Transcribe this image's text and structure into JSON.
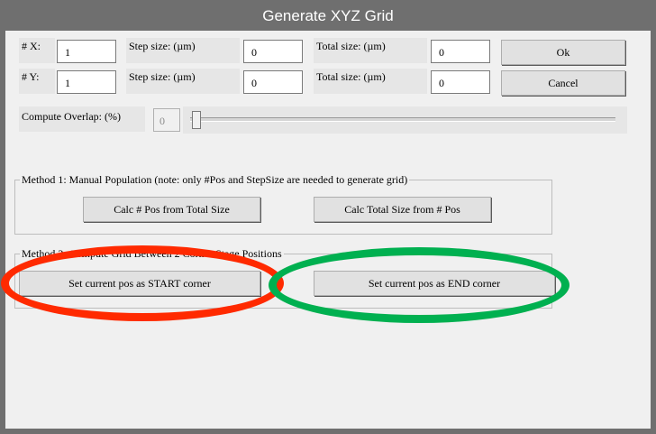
{
  "window": {
    "title": "Generate XYZ Grid",
    "bg_color": "#6f6f6f",
    "client_bg": "#f0f0f0"
  },
  "grid": {
    "x_label": "# X:",
    "x_value": "1",
    "y_label": "# Y:",
    "y_value": "1",
    "step_label_x": "Step size: (µm)",
    "step_value_x": "0",
    "step_label_y": "Step size: (µm)",
    "step_value_y": "0",
    "total_label_x": "Total size: (µm)",
    "total_value_x": "0",
    "total_label_y": "Total size: (µm)",
    "total_value_y": "0"
  },
  "buttons": {
    "ok": "Ok",
    "cancel": "Cancel"
  },
  "overlap": {
    "label": "Compute Overlap: (%)",
    "value": "0",
    "slider_level": 0
  },
  "method1": {
    "legend": "Method 1: Manual Population (note: only #Pos and StepSize are needed to generate grid)",
    "calc_pos_button": "Calc # Pos from Total Size",
    "calc_total_button": "Calc Total Size from # Pos"
  },
  "method2": {
    "legend": "Method 2: Compute Grid Between 2 Corner Stage Positions",
    "start_button": "Set current pos as START corner",
    "end_button": "Set current pos as END corner"
  },
  "annotations": {
    "start_ellipse_color": "#ff2a00",
    "end_ellipse_color": "#00b050"
  }
}
